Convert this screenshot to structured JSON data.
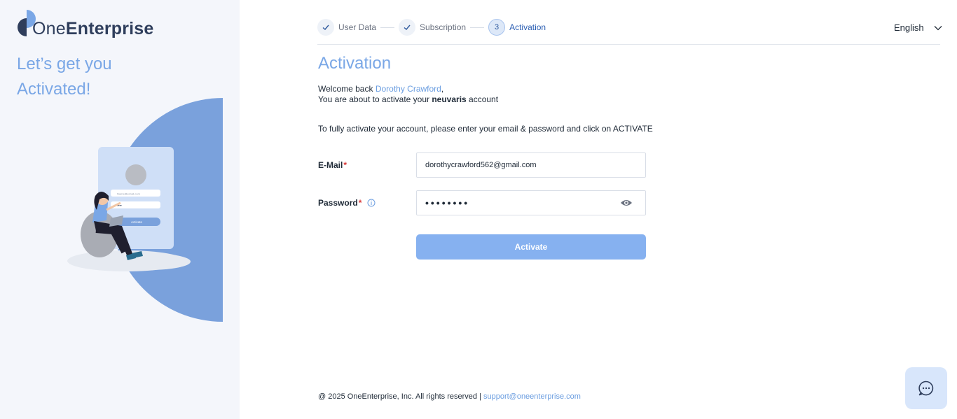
{
  "brand": {
    "name_part1": "One",
    "name_part2": "Enterprise",
    "tagline": "Let’s get you Activated!",
    "accent": "#7aa7e6"
  },
  "illustration": {
    "email_placeholder": "Name@email.com",
    "password_placeholder": "•••••",
    "button_label": "Activate"
  },
  "stepper": {
    "steps": [
      {
        "label": "User Data",
        "icon": "check-icon",
        "state": "done"
      },
      {
        "label": "Subscription",
        "icon": "check-icon",
        "state": "done"
      },
      {
        "label": "Activation",
        "number": "3",
        "state": "active"
      }
    ]
  },
  "language": {
    "selected": "English"
  },
  "main": {
    "title": "Activation",
    "welcome_prefix": "Welcome back ",
    "user_name": "Dorothy Crawford",
    "welcome_suffix": ",",
    "account_prefix": "You are about to activate your ",
    "account_name": "neuvaris",
    "account_suffix": " account",
    "instructions": "To fully activate your account, please enter your email & password and click on ACTIVATE"
  },
  "form": {
    "email_label": "E-Mail",
    "email_value": "dorothycrawford562@gmail.com",
    "password_label": "Password",
    "password_value": "••••••••",
    "required_mark": "*",
    "submit_label": "Activate"
  },
  "footer": {
    "copyright": "@ 2025 OneEnterprise, Inc. All rights reserved | ",
    "support_email": "support@oneenterprise.com"
  },
  "colors": {
    "left_panel_bg": "#f4f6fb",
    "button_bg": "#86b1f0",
    "link": "#6a9de0",
    "required": "#d93a3a"
  }
}
